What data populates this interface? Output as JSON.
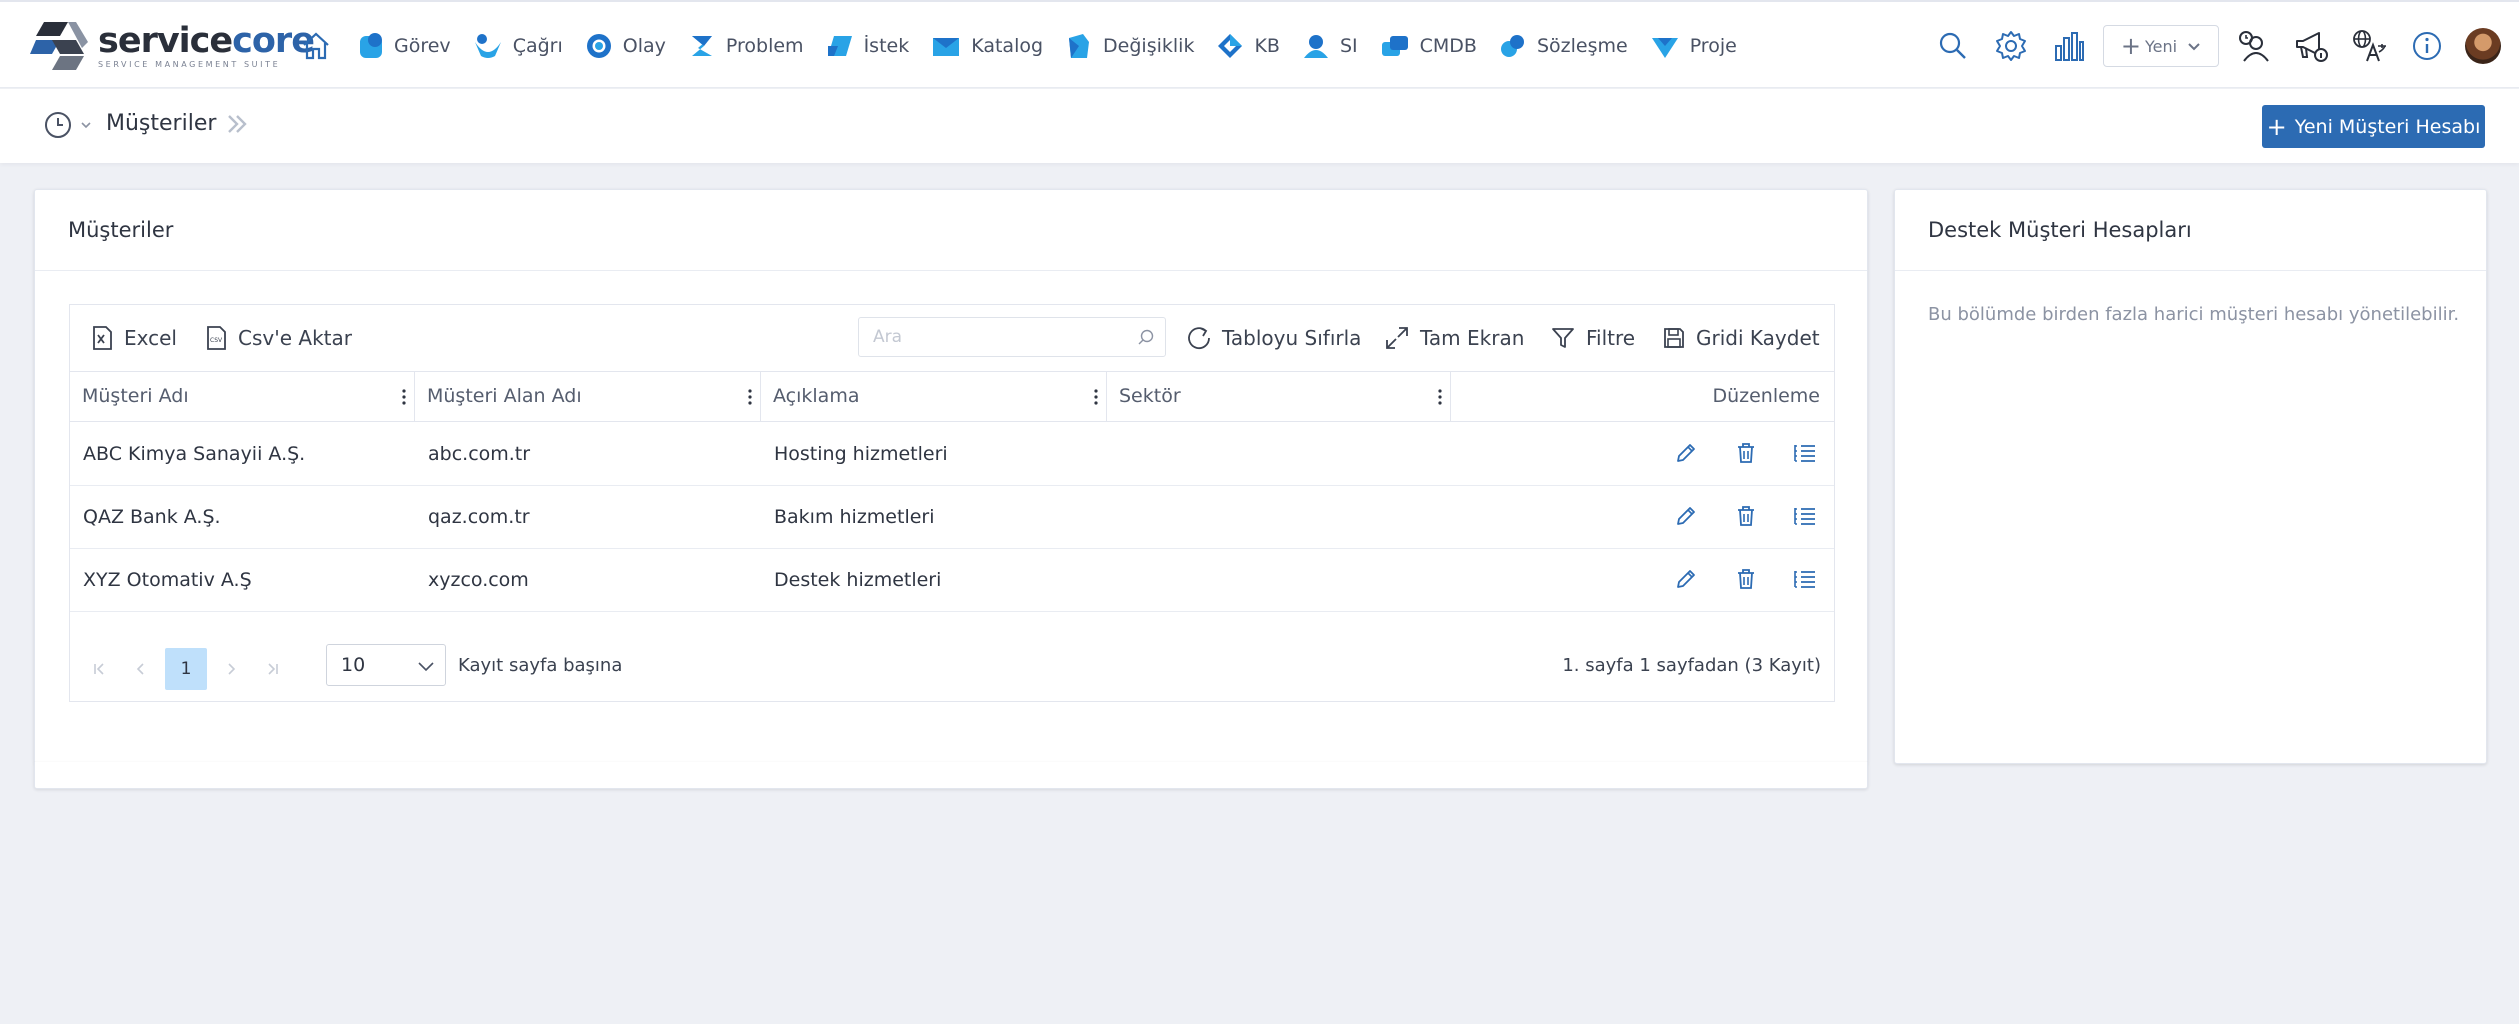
{
  "brand": {
    "name_main": "service",
    "name_accent": "core",
    "tagline": "SERVICE MANAGEMENT SUITE",
    "accent_color": "#2c6bb3"
  },
  "nav": {
    "items": [
      {
        "label": "Görev",
        "icon": "task-icon"
      },
      {
        "label": "Çağrı",
        "icon": "call-icon"
      },
      {
        "label": "Olay",
        "icon": "incident-icon"
      },
      {
        "label": "Problem",
        "icon": "problem-icon"
      },
      {
        "label": "İstek",
        "icon": "request-icon"
      },
      {
        "label": "Katalog",
        "icon": "catalog-icon"
      },
      {
        "label": "Değişiklik",
        "icon": "change-icon"
      },
      {
        "label": "KB",
        "icon": "knowledge-base-icon"
      },
      {
        "label": "SI",
        "icon": "si-icon"
      },
      {
        "label": "CMDB",
        "icon": "cmdb-icon"
      },
      {
        "label": "Sözleşme",
        "icon": "contract-icon"
      },
      {
        "label": "Proje",
        "icon": "project-icon"
      }
    ],
    "new_label": "Yeni"
  },
  "subheader": {
    "title": "Müşteriler",
    "new_account_label": "Yeni Müşteri Hesabı"
  },
  "main": {
    "title": "Müşteriler",
    "toolbar": {
      "excel": "Excel",
      "csv": "Csv'e Aktar",
      "search_placeholder": "Ara",
      "reset": "Tabloyu Sıfırla",
      "fullscreen": "Tam Ekran",
      "filter": "Filtre",
      "save_grid": "Gridi Kaydet"
    },
    "columns": {
      "name": "Müşteri Adı",
      "domain": "Müşteri Alan Adı",
      "description": "Açıklama",
      "sector": "Sektör",
      "edit": "Düzenleme"
    },
    "rows": [
      {
        "name": "ABC Kimya Sanayii A.Ş.",
        "domain": "abc.com.tr",
        "description": "Hosting hizmetleri",
        "sector": ""
      },
      {
        "name": "QAZ Bank A.Ş.",
        "domain": "qaz.com.tr",
        "description": "Bakım hizmetleri",
        "sector": ""
      },
      {
        "name": "XYZ Otomativ A.Ş",
        "domain": "xyzco.com",
        "description": "Destek hizmetleri",
        "sector": ""
      }
    ],
    "pager": {
      "current_page": "1",
      "page_size": "10",
      "per_page_label": "Kayıt sayfa başına",
      "info": "1. sayfa 1 sayfadan (3 Kayıt)"
    }
  },
  "side": {
    "title": "Destek Müşteri Hesapları",
    "description": "Bu bölümde birden fazla harici müşteri hesabı yönetilebilir."
  }
}
